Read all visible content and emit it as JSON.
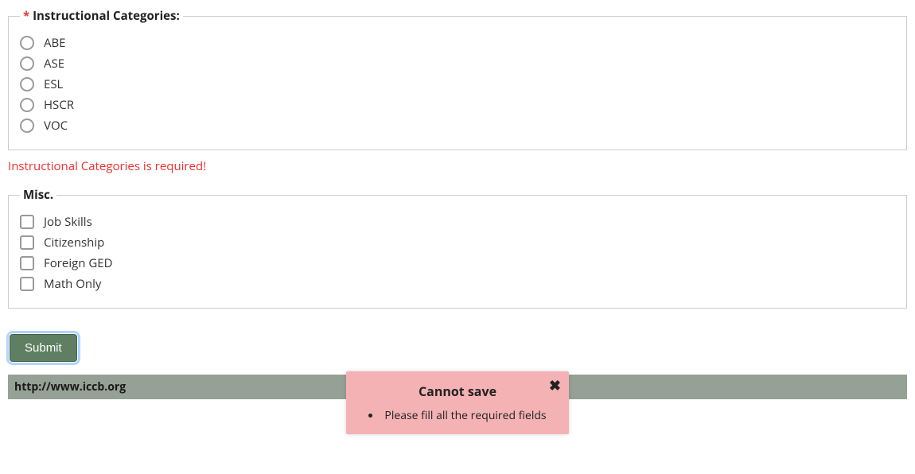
{
  "instructionalCategories": {
    "legendRequiredMark": "*",
    "legendText": "Instructional Categories:",
    "options": [
      {
        "label": "ABE"
      },
      {
        "label": "ASE"
      },
      {
        "label": "ESL"
      },
      {
        "label": "HSCR"
      },
      {
        "label": "VOC"
      }
    ],
    "validationError": "Instructional Categories is required!"
  },
  "misc": {
    "legendText": "Misc.",
    "options": [
      {
        "label": "Job Skills"
      },
      {
        "label": "Citizenship"
      },
      {
        "label": "Foreign GED"
      },
      {
        "label": "Math Only"
      }
    ]
  },
  "buttons": {
    "submit": "Submit"
  },
  "footer": {
    "url": "http://www.iccb.org"
  },
  "toast": {
    "title": "Cannot save",
    "items": [
      "Please fill all the required fields"
    ],
    "closeGlyph": "✖"
  }
}
